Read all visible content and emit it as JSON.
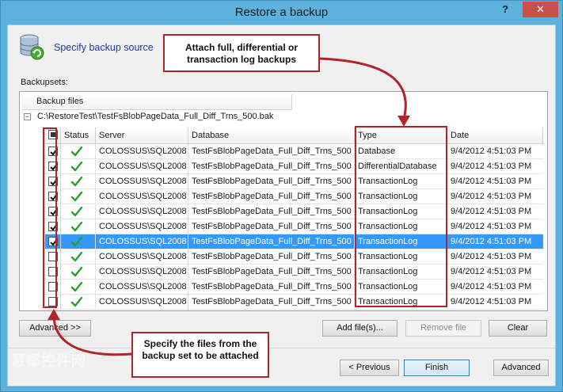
{
  "window": {
    "title": "Restore a backup",
    "help_glyph": "?",
    "close_glyph": "✕"
  },
  "step": {
    "title": "Specify backup source",
    "icon": "database-refresh-icon"
  },
  "backupsets_label": "Backupsets:",
  "files_column_header": "Backup files",
  "file_path": "C:\\RestoreTest\\TestFsBlobPageData_Full_Diff_Trns_500.bak",
  "expander_glyph": "−",
  "columns": [
    "Status",
    "Server",
    "Database",
    "Type",
    "Date"
  ],
  "rows": [
    {
      "checked": true,
      "server": "COLOSSUS\\SQL2008",
      "database": "TestFsBlobPageData_Full_Diff_Trns_500",
      "type": "Database",
      "date": "9/4/2012 4:51:03 PM",
      "selected": false
    },
    {
      "checked": true,
      "server": "COLOSSUS\\SQL2008",
      "database": "TestFsBlobPageData_Full_Diff_Trns_500",
      "type": "DifferentialDatabase",
      "date": "9/4/2012 4:51:03 PM",
      "selected": false
    },
    {
      "checked": true,
      "server": "COLOSSUS\\SQL2008",
      "database": "TestFsBlobPageData_Full_Diff_Trns_500",
      "type": "TransactionLog",
      "date": "9/4/2012 4:51:03 PM",
      "selected": false
    },
    {
      "checked": true,
      "server": "COLOSSUS\\SQL2008",
      "database": "TestFsBlobPageData_Full_Diff_Trns_500",
      "type": "TransactionLog",
      "date": "9/4/2012 4:51:03 PM",
      "selected": false
    },
    {
      "checked": true,
      "server": "COLOSSUS\\SQL2008",
      "database": "TestFsBlobPageData_Full_Diff_Trns_500",
      "type": "TransactionLog",
      "date": "9/4/2012 4:51:03 PM",
      "selected": false
    },
    {
      "checked": true,
      "server": "COLOSSUS\\SQL2008",
      "database": "TestFsBlobPageData_Full_Diff_Trns_500",
      "type": "TransactionLog",
      "date": "9/4/2012 4:51:03 PM",
      "selected": false
    },
    {
      "checked": true,
      "server": "COLOSSUS\\SQL2008",
      "database": "TestFsBlobPageData_Full_Diff_Trns_500",
      "type": "TransactionLog",
      "date": "9/4/2012 4:51:03 PM",
      "selected": true
    },
    {
      "checked": false,
      "server": "COLOSSUS\\SQL2008",
      "database": "TestFsBlobPageData_Full_Diff_Trns_500",
      "type": "TransactionLog",
      "date": "9/4/2012 4:51:03 PM",
      "selected": false
    },
    {
      "checked": false,
      "server": "COLOSSUS\\SQL2008",
      "database": "TestFsBlobPageData_Full_Diff_Trns_500",
      "type": "TransactionLog",
      "date": "9/4/2012 4:51:03 PM",
      "selected": false
    },
    {
      "checked": false,
      "server": "COLOSSUS\\SQL2008",
      "database": "TestFsBlobPageData_Full_Diff_Trns_500",
      "type": "TransactionLog",
      "date": "9/4/2012 4:51:03 PM",
      "selected": false
    },
    {
      "checked": false,
      "server": "COLOSSUS\\SQL2008",
      "database": "TestFsBlobPageData_Full_Diff_Trns_500",
      "type": "TransactionLog",
      "date": "9/4/2012 4:51:03 PM",
      "selected": false
    }
  ],
  "buttons": {
    "advanced_toggle": "Advanced >>",
    "add_files": "Add file(s)...",
    "remove_file": "Remove file",
    "clear": "Clear",
    "previous": "< Previous",
    "finish": "Finish",
    "advanced": "Advanced"
  },
  "annotations": {
    "top": "Attach full, differential or transaction log backups",
    "bottom": "Specify the files from the backup set to be attached"
  },
  "watermark": "慧都控件网",
  "colors": {
    "titlebar": "#5cb2dc",
    "close": "#c7504b",
    "selection": "#3399ff",
    "annotation": "#b1242a",
    "check_ok": "#2c9e2c"
  }
}
